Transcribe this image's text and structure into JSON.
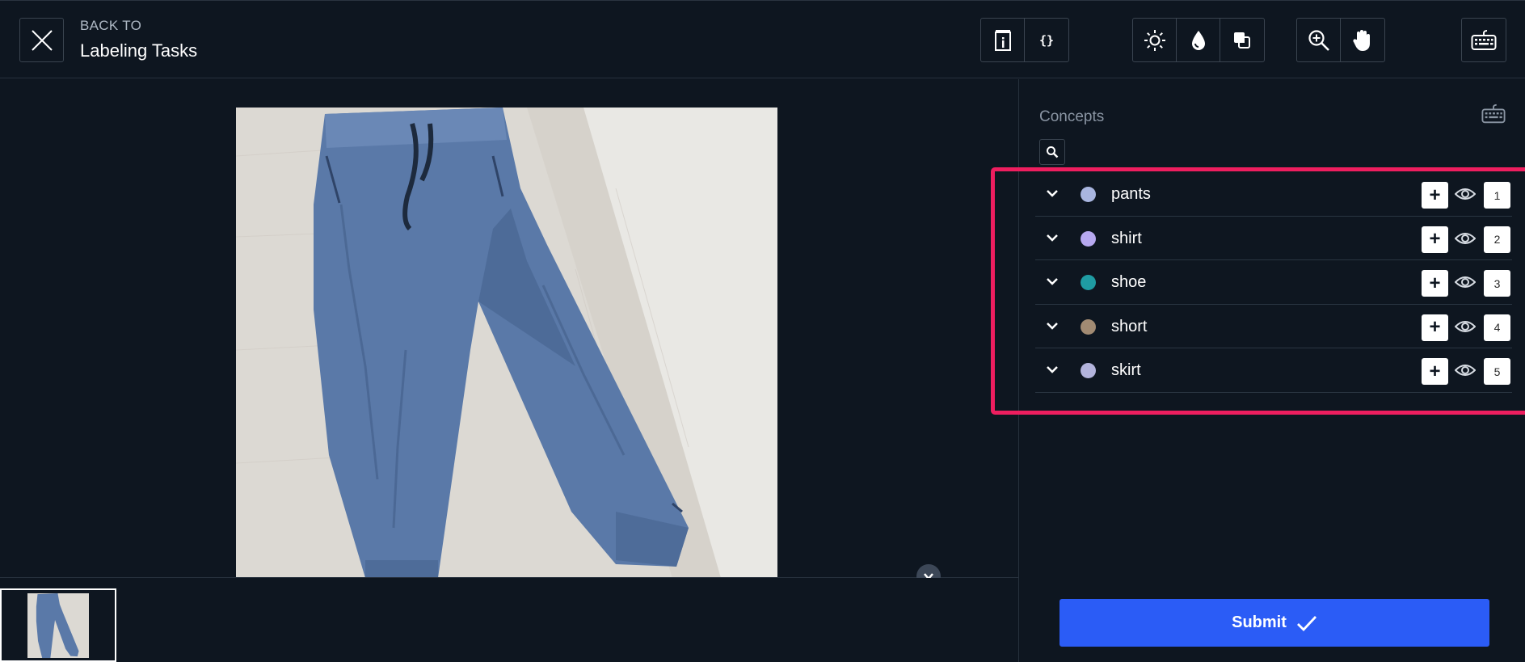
{
  "header": {
    "back_small": "BACK TO",
    "back_title": "Labeling Tasks"
  },
  "toolbar": {
    "groups": [
      [
        "info-icon",
        "code-braces-icon"
      ],
      [
        "brightness-icon",
        "drop-icon",
        "overlay-icon"
      ],
      [
        "zoom-in-icon",
        "pan-hand-icon"
      ],
      [
        "keyboard-icon"
      ]
    ]
  },
  "sidebar": {
    "title": "Concepts",
    "concepts": [
      {
        "label": "pants",
        "color": "#a9b6e0",
        "hotkey": "1"
      },
      {
        "label": "shirt",
        "color": "#b7a9f0",
        "hotkey": "2"
      },
      {
        "label": "shoe",
        "color": "#1f9ca3",
        "hotkey": "3"
      },
      {
        "label": "short",
        "color": "#a28b73",
        "hotkey": "4"
      },
      {
        "label": "skirt",
        "color": "#b3b4dc",
        "hotkey": "5"
      }
    ]
  },
  "submit": {
    "label": "Submit"
  },
  "colors": {
    "background": "#0e1620",
    "accent": "#2b5cf6",
    "highlight": "#ee1e5f"
  }
}
